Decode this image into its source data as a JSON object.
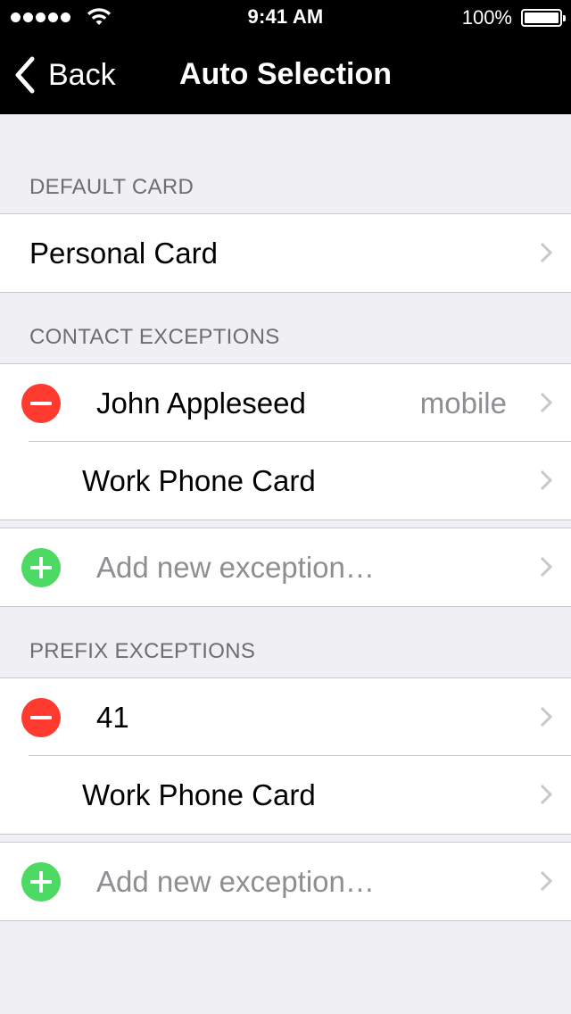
{
  "status_bar": {
    "time": "9:41 AM",
    "battery": "100%",
    "icons": [
      "signal-dots-icon",
      "wifi-icon",
      "battery-icon"
    ]
  },
  "nav": {
    "back_label": "Back",
    "title": "Auto Selection",
    "back_icon": "chevron-left-icon"
  },
  "sections": {
    "default_card": {
      "header": "DEFAULT CARD",
      "rows": [
        {
          "label": "Personal Card"
        }
      ]
    },
    "contact_exceptions": {
      "header": "CONTACT EXCEPTIONS",
      "entry": {
        "name": "John Appleseed",
        "detail": "mobile",
        "card": "Work Phone Card"
      },
      "add_label": "Add new exception…"
    },
    "prefix_exceptions": {
      "header": "PREFIX EXCEPTIONS",
      "entry": {
        "name": "41",
        "card": "Work Phone Card"
      },
      "add_label": "Add new exception…"
    }
  },
  "colors": {
    "background": "#efeff4",
    "delete": "#ff3b30",
    "add": "#4cd964",
    "secondary_text": "#8e8e93",
    "header_text": "#6d6d72"
  }
}
